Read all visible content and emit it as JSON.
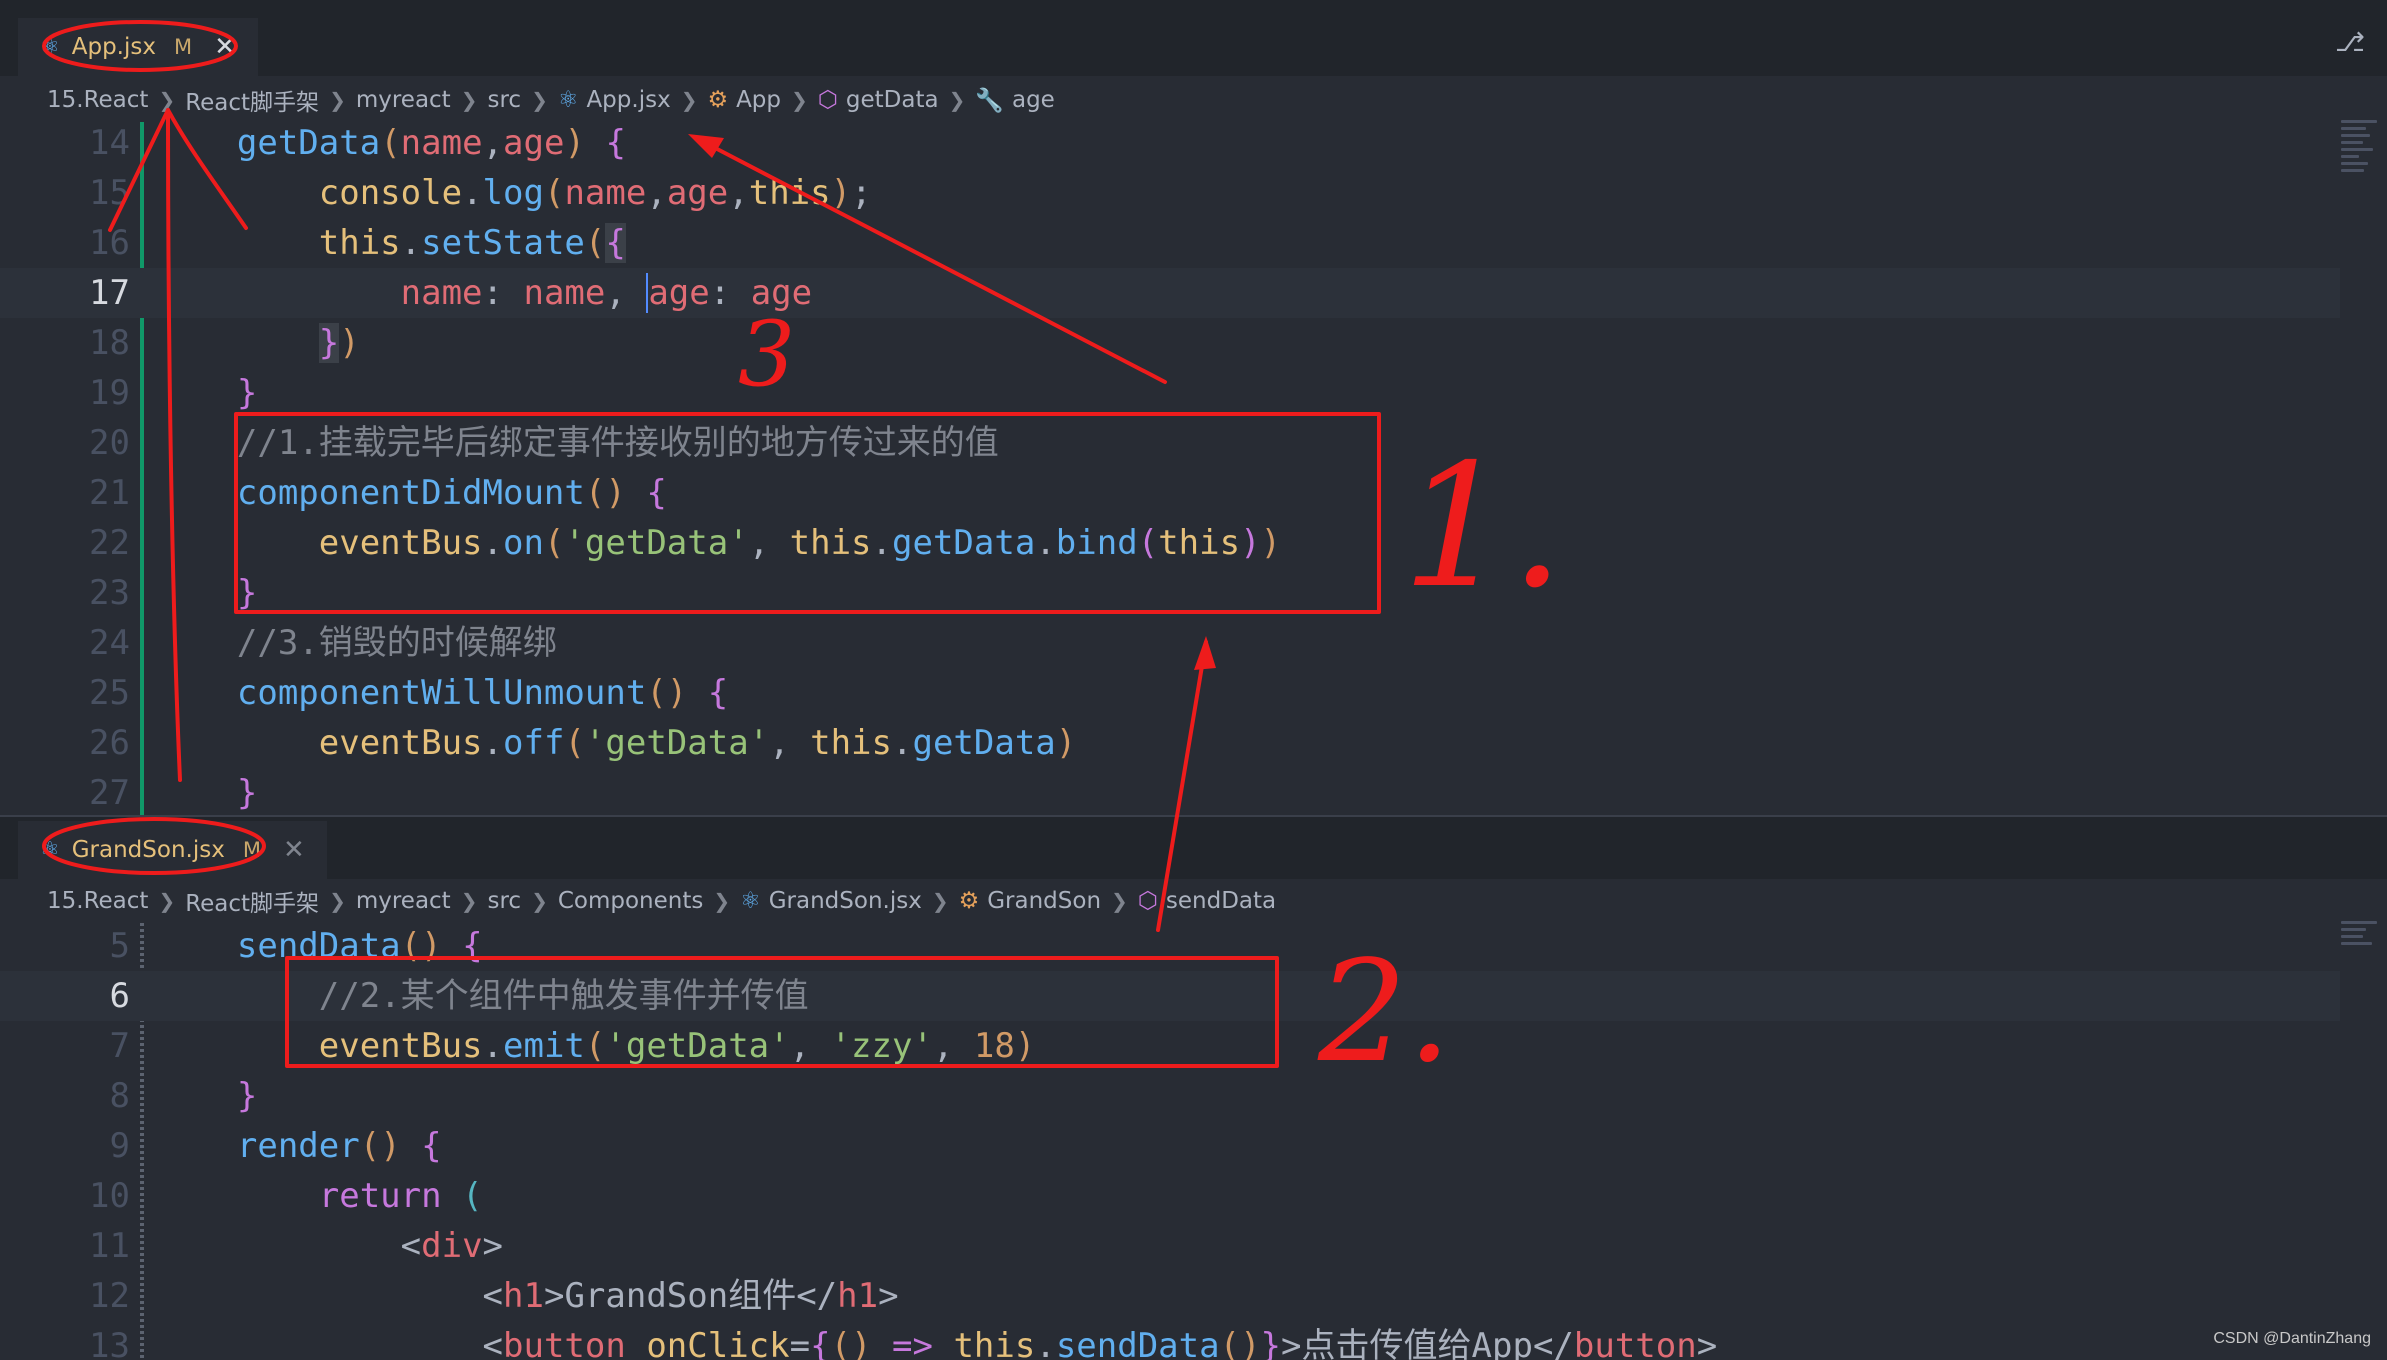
{
  "top_editor": {
    "tab": {
      "filename": "App.jsx",
      "status": "M",
      "close": "✕"
    },
    "breadcrumb": [
      "15.React",
      "React脚手架",
      "myreact",
      "src",
      "App.jsx",
      "App",
      "getData",
      "age"
    ],
    "lines": [
      {
        "n": "14"
      },
      {
        "n": "15"
      },
      {
        "n": "16"
      },
      {
        "n": "17"
      },
      {
        "n": "18"
      },
      {
        "n": "19"
      },
      {
        "n": "20"
      },
      {
        "n": "21"
      },
      {
        "n": "22"
      },
      {
        "n": "23"
      },
      {
        "n": "24"
      },
      {
        "n": "25"
      },
      {
        "n": "26"
      },
      {
        "n": "27"
      }
    ],
    "code": {
      "l14": {
        "fn": "getData",
        "p1": "name",
        "p2": "age"
      },
      "l15": {
        "obj": "console",
        "fn": "log",
        "a1": "name",
        "a2": "age",
        "a3": "this"
      },
      "l16": {
        "this": "this",
        "fn": "setState"
      },
      "l17": {
        "k1": "name",
        "v1": "name",
        "k2": "age",
        "v2": "age"
      },
      "l20": {
        "comment": "//1.挂载完毕后绑定事件接收别的地方传过来的值"
      },
      "l21": {
        "fn": "componentDidMount"
      },
      "l22": {
        "obj": "eventBus",
        "fn": "on",
        "str": "'getData'",
        "this1": "this",
        "m1": "getData",
        "m2": "bind",
        "this2": "this"
      },
      "l24": {
        "comment": "//3.销毁的时候解绑"
      },
      "l25": {
        "fn": "componentWillUnmount"
      },
      "l26": {
        "obj": "eventBus",
        "fn": "off",
        "str": "'getData'",
        "this1": "this",
        "m1": "getData"
      }
    }
  },
  "bottom_editor": {
    "tab": {
      "filename": "GrandSon.jsx",
      "status": "M",
      "close": "✕"
    },
    "breadcrumb": [
      "15.React",
      "React脚手架",
      "myreact",
      "src",
      "Components",
      "GrandSon.jsx",
      "GrandSon",
      "sendData"
    ],
    "lines": [
      {
        "n": "5"
      },
      {
        "n": "6"
      },
      {
        "n": "7"
      },
      {
        "n": "8"
      },
      {
        "n": "9"
      },
      {
        "n": "10"
      },
      {
        "n": "11"
      },
      {
        "n": "12"
      },
      {
        "n": "13"
      }
    ],
    "code": {
      "l5": {
        "fn": "sendData"
      },
      "l6": {
        "comment": "//2.某个组件中触发事件并传值"
      },
      "l7": {
        "obj": "eventBus",
        "fn": "emit",
        "s1": "'getData'",
        "s2": "'zzy'",
        "num": "18"
      },
      "l9": {
        "fn": "render"
      },
      "l10": {
        "kw": "return"
      },
      "l11": {
        "tag": "div"
      },
      "l12": {
        "tag": "h1",
        "text": "GrandSon组件"
      },
      "l13": {
        "tag": "button",
        "attr": "onClick",
        "this": "this",
        "fn": "sendData",
        "text": "点击传值给App"
      }
    }
  },
  "annotations": {
    "labels": [
      "1.",
      "2.",
      "3"
    ],
    "color": "#ee1c1c"
  },
  "watermark": "CSDN @DantinZhang",
  "colors": {
    "editor_bg": "#282c34",
    "keyword": "#c678dd",
    "function": "#61afef",
    "string": "#98c379",
    "variable": "#e06c75"
  }
}
